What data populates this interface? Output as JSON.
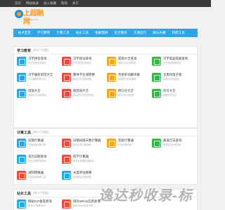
{
  "topbar": {
    "links": [
      "首页",
      "网站收录",
      "加入收藏",
      "帮助",
      "关于"
    ]
  },
  "logo": {
    "text": "上超融网",
    "sub": "chinaweb.com"
  },
  "nav": {
    "items": [
      "站点首页",
      "学习教育",
      "计算工具",
      "站长工具",
      "金融理财",
      "生活服务",
      "交通出行",
      "娱乐乐趣",
      "科研工具"
    ]
  },
  "sections": [
    {
      "title": "学习教育",
      "count": "(共37个应用)",
      "tools": [
        {
          "name": "汉字拼音查询",
          "desc": "汉字拼音在线查询",
          "color": "#2fa5e8"
        },
        {
          "name": "汉字组词查询",
          "desc": "汉字组词在线查询",
          "color": "#f04c3c"
        },
        {
          "name": "成语大全查询",
          "desc": "成语大全在线查询",
          "color": "#f5a623"
        },
        {
          "name": "汉字笔画笔顺查询",
          "desc": "汉字笔画笔顺查询",
          "color": "#3db54a"
        },
        {
          "name": "汉字偏旁部首大全",
          "desc": "汉字偏旁部首大全",
          "color": "#2fa5e8"
        },
        {
          "name": "繁体字在线转换",
          "desc": "繁体字在线转换器",
          "color": "#f04c3c"
        },
        {
          "name": "英语单词翻译器",
          "desc": "英语单词在线翻译",
          "color": "#f5a623"
        },
        {
          "name": "全唐诗电子版",
          "desc": "全唐诗在线阅读",
          "color": "#3db54a"
        },
        {
          "name": "谜语大全",
          "desc": "谜语大全在线查询",
          "color": "#2fa5e8"
        },
        {
          "name": "歇后语大全",
          "desc": "歇后语大全在线查询",
          "color": "#f04c3c"
        },
        {
          "name": "绕口令大全",
          "desc": "绕口令大全在线",
          "color": "#f5a623"
        },
        {
          "name": "符号大全",
          "desc": "特殊符号大全",
          "color": "#3db54a"
        }
      ]
    },
    {
      "title": "计算工具",
      "count": "(共27个应用)",
      "tools": [
        {
          "name": "日期计算器",
          "desc": "日期间隔天数计算",
          "color": "#2fa5e8"
        },
        {
          "name": "日期间隔天数计算器",
          "desc": "在线计算日期间隔",
          "color": "#f04c3c"
        },
        {
          "name": "年龄计算器",
          "desc": "在线计算年龄",
          "color": "#f5a623"
        },
        {
          "name": "黄道吉日查询",
          "desc": "黄道吉日在线查询",
          "color": "#3db54a"
        },
        {
          "name": "农历日期查询",
          "desc": "农历日期在线查询",
          "color": "#2fa5e8"
        },
        {
          "name": "科学计算器",
          "desc": "科学计算器在线使用",
          "color": "#f04c3c"
        },
        {
          "name": "",
          "desc": "",
          "color": ""
        },
        {
          "name": "",
          "desc": "",
          "color": ""
        },
        {
          "name": "进制转换器",
          "desc": "在线进制转换工具",
          "color": "#f04c3c"
        },
        {
          "name": "长度单位换算",
          "desc": "长度单位在线换算",
          "color": "#2fa5e8"
        },
        {
          "name": "",
          "desc": "",
          "color": ""
        },
        {
          "name": "",
          "desc": "",
          "color": ""
        }
      ]
    },
    {
      "title": "站长工具",
      "count": "(共21个应用)",
      "tools": [
        {
          "name": "网站ICP备案查询",
          "desc": "网站ICP备案查询",
          "color": "#2fa5e8"
        },
        {
          "name": "域名Whois信息查询",
          "desc": "域名Whois信息查询",
          "color": "#f04c3c"
        },
        {
          "name": "",
          "desc": "",
          "color": ""
        },
        {
          "name": "",
          "desc": "",
          "color": ""
        }
      ]
    }
  ],
  "watermark": "逸达秒收录-标"
}
